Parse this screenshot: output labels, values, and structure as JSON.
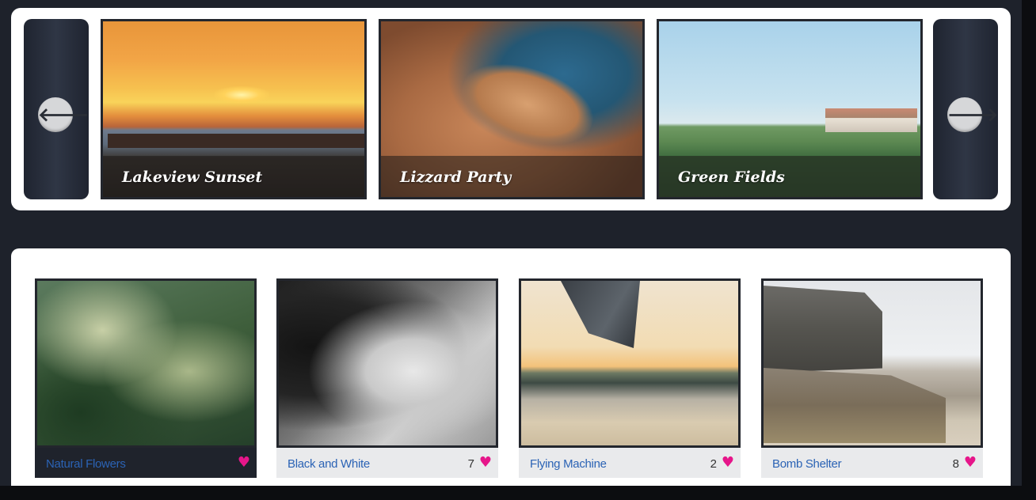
{
  "slider": {
    "prev_icon": "arrow-left-icon",
    "next_icon": "arrow-right-icon",
    "prev_glyph": "🡐",
    "next_glyph": "🡒",
    "slides": [
      {
        "caption": "Lakeview Sunset"
      },
      {
        "caption": "Lizzard Party"
      },
      {
        "caption": "Green Fields"
      }
    ]
  },
  "gallery": {
    "items": [
      {
        "title": "Natural Flowers",
        "likes": "",
        "heart": "♥"
      },
      {
        "title": "Black and White",
        "likes": "7",
        "heart": "♥"
      },
      {
        "title": "Flying Machine",
        "likes": "2",
        "heart": "♥"
      },
      {
        "title": "Bomb Shelter",
        "likes": "8",
        "heart": "♥"
      }
    ]
  },
  "colors": {
    "background": "#1e222b",
    "panel": "#ffffff",
    "link": "#2b63b5",
    "heart": "#e6168a"
  }
}
